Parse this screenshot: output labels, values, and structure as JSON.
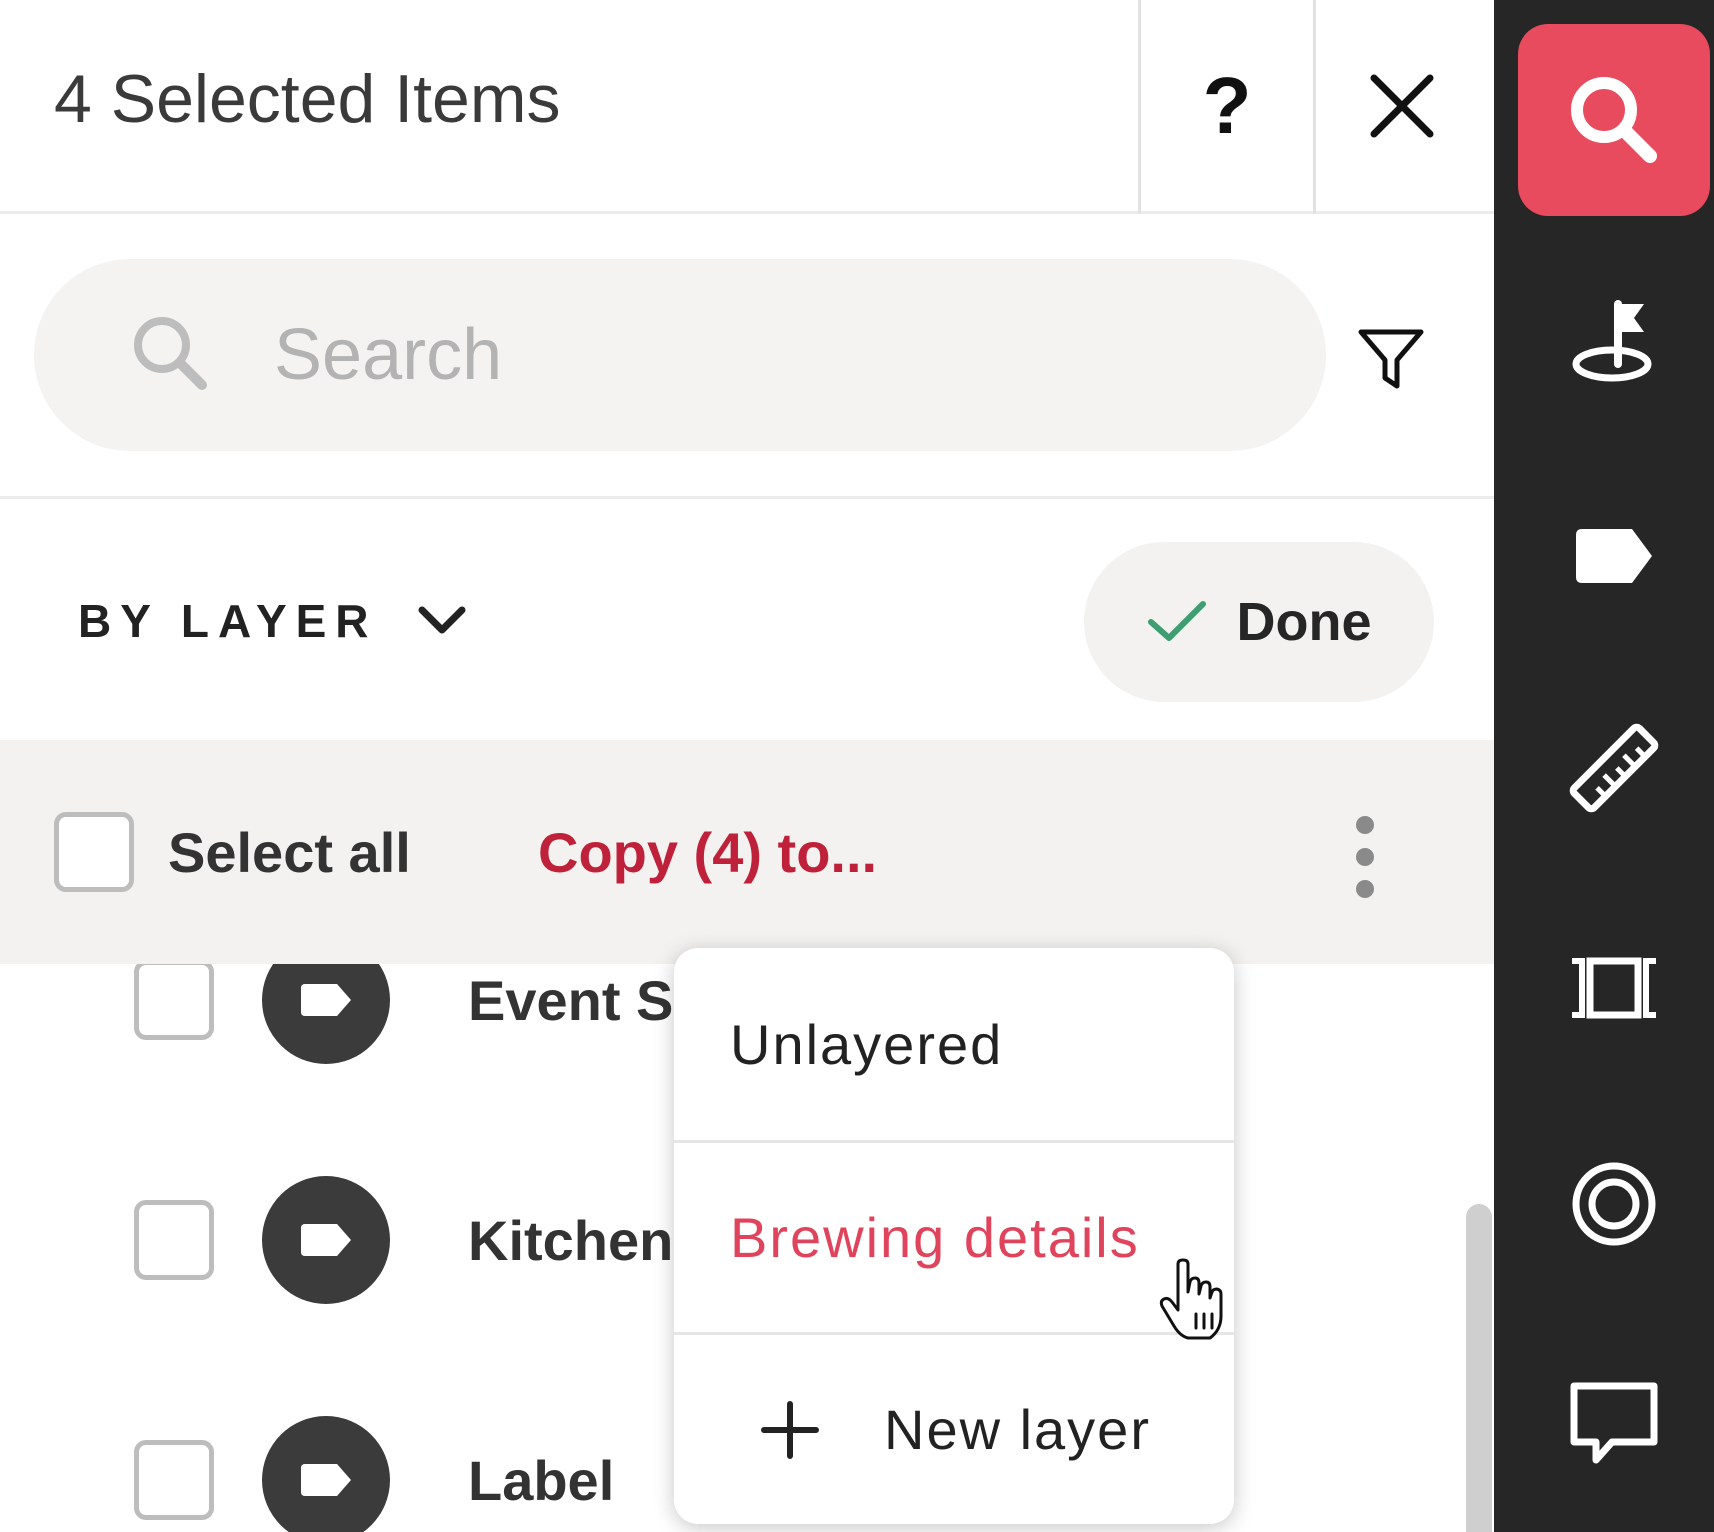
{
  "header": {
    "title": "4 Selected Items",
    "help_label": "?",
    "close_icon": "close-icon"
  },
  "search": {
    "placeholder": "Search",
    "value": "",
    "icon": "search-icon",
    "filter_icon": "filter-icon"
  },
  "grouping": {
    "label": "BY LAYER",
    "icon": "chevron-down-icon",
    "done_label": "Done",
    "done_icon": "check-icon"
  },
  "selection": {
    "select_all_label": "Select all",
    "copy_label": "Copy (4) to...",
    "more_icon": "kebab-icon"
  },
  "items": [
    {
      "name": "Event S",
      "icon": "tag-icon"
    },
    {
      "name": "Kitchen",
      "icon": "tag-icon"
    },
    {
      "name": "Label",
      "icon": "tag-icon"
    }
  ],
  "menu": {
    "items": [
      {
        "label": "Unlayered"
      },
      {
        "label": "Brewing details"
      },
      {
        "label": "New layer",
        "icon": "plus-icon"
      }
    ]
  },
  "toolbar": {
    "tools": [
      "search-icon",
      "pin-flag-icon",
      "tag-icon",
      "ruler-icon",
      "dimension-icon",
      "target-icon",
      "comment-icon"
    ],
    "active": "search-icon"
  },
  "colors": {
    "accent": "#e84a5e",
    "copy_link": "#c0213a",
    "menu_highlight": "#e0445d",
    "done_check": "#3e9e72",
    "toolbar_bg": "#262626"
  }
}
